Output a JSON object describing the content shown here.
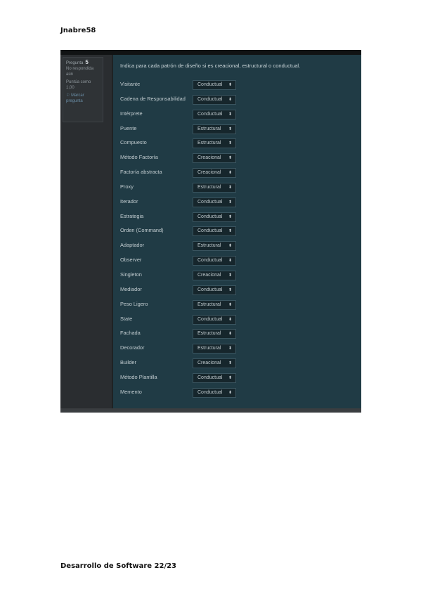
{
  "page": {
    "header": "Jnabre58",
    "footer": "Desarrollo de Software 22/23"
  },
  "info": {
    "question_label": "Pregunta",
    "question_number": "5",
    "status_line1": "No respondida",
    "status_line2": "aún",
    "score_line1": "Puntúa como",
    "score_line2": "1,00",
    "flag_line1": "Marcar",
    "flag_line2": "pregunta"
  },
  "instruction": "Indica para cada patrón de diseño si es creacional, estructural o conductual.",
  "rows": [
    {
      "label": "Visitante",
      "value": "Conductual"
    },
    {
      "label": "Cadena de Responsabilidad",
      "value": "Conductual"
    },
    {
      "label": "Intérprete",
      "value": "Conductual"
    },
    {
      "label": "Puente",
      "value": "Estructural"
    },
    {
      "label": "Compuesto",
      "value": "Estructural"
    },
    {
      "label": "Método Factoría",
      "value": "Creacional"
    },
    {
      "label": "Factoría abstracta",
      "value": "Creacional"
    },
    {
      "label": "Proxy",
      "value": "Estructural"
    },
    {
      "label": "Iterador",
      "value": "Conductual"
    },
    {
      "label": "Estrategia",
      "value": "Conductual"
    },
    {
      "label": "Orden (Command)",
      "value": "Conductual"
    },
    {
      "label": "Adaptador",
      "value": "Estructural"
    },
    {
      "label": "Observer",
      "value": "Conductual"
    },
    {
      "label": "Singleton",
      "value": "Creacional"
    },
    {
      "label": "Mediador",
      "value": "Conductual"
    },
    {
      "label": "Peso Ligero",
      "value": "Estructural"
    },
    {
      "label": "State",
      "value": "Conductual"
    },
    {
      "label": "Fachada",
      "value": "Estructural"
    },
    {
      "label": "Decorador",
      "value": "Estructural"
    },
    {
      "label": "Builder",
      "value": "Creacional"
    },
    {
      "label": "Método Plantilla",
      "value": "Conductual"
    },
    {
      "label": "Memento",
      "value": "Conductual"
    }
  ],
  "icons": {
    "select_arrow": "updown-arrow-icon",
    "flag": "flag-icon"
  }
}
